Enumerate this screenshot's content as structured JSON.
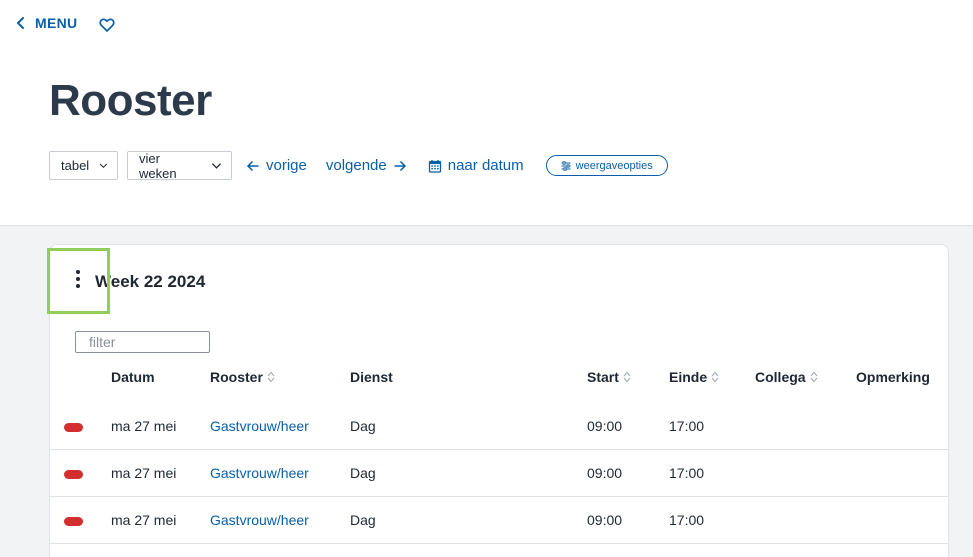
{
  "nav": {
    "menu_label": "MENU"
  },
  "page": {
    "title": "Rooster"
  },
  "toolbar": {
    "view_select": "tabel",
    "range_select": "vier weken",
    "prev_label": "vorige",
    "next_label": "volgende",
    "date_label": "naar datum",
    "options_label": "weergaveopties"
  },
  "week": {
    "title": "Week 22 2024",
    "filter_placeholder": "filter"
  },
  "table": {
    "columns": [
      "Datum",
      "Rooster",
      "Dienst",
      "Start",
      "Einde",
      "Collega",
      "Opmerking"
    ],
    "rows": [
      {
        "status": "red",
        "datum": "ma 27 mei",
        "rooster": "Gastvrouw/heer",
        "dienst": "Dag",
        "start": "09:00",
        "einde": "17:00",
        "collega": "",
        "opmerking": ""
      },
      {
        "status": "red",
        "datum": "ma 27 mei",
        "rooster": "Gastvrouw/heer",
        "dienst": "Dag",
        "start": "09:00",
        "einde": "17:00",
        "collega": "",
        "opmerking": ""
      },
      {
        "status": "red",
        "datum": "ma 27 mei",
        "rooster": "Gastvrouw/heer",
        "dienst": "Dag",
        "start": "09:00",
        "einde": "17:00",
        "collega": "",
        "opmerking": ""
      }
    ]
  },
  "colors": {
    "accent": "#0a5fa8",
    "status_red": "#d32f2f",
    "highlight": "#92cf5a"
  },
  "icons": [
    "chevron-left-icon",
    "heart-icon",
    "chevron-down-icon",
    "arrow-left-icon",
    "arrow-right-icon",
    "calendar-icon",
    "sliders-icon",
    "kebab-icon",
    "sort-icon"
  ]
}
